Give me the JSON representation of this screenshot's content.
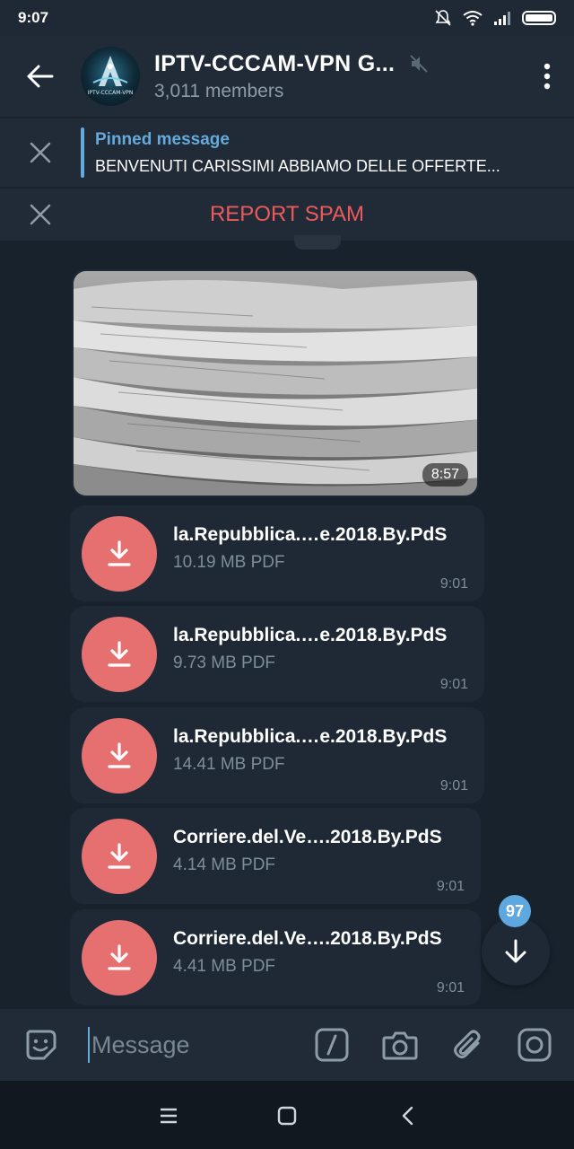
{
  "status_bar": {
    "time": "9:07"
  },
  "header": {
    "title": "IPTV-CCCAM-VPN G...",
    "subtitle": "3,011 members",
    "avatar_text": "IPTV-CCCAM-VPN"
  },
  "pinned": {
    "title": "Pinned message",
    "text": "BENVENUTI CARISSIMI ABBIAMO DELLE OFFERTE..."
  },
  "spam": {
    "label": "REPORT SPAM"
  },
  "messages": {
    "photo": {
      "time": "8:57"
    },
    "files": [
      {
        "name": "la.Repubblica.…e.2018.By.PdS",
        "size": "10.19 MB PDF",
        "time": "9:01"
      },
      {
        "name": "la.Repubblica.…e.2018.By.PdS",
        "size": "9.73 MB PDF",
        "time": "9:01"
      },
      {
        "name": "la.Repubblica.…e.2018.By.PdS",
        "size": "14.41 MB PDF",
        "time": "9:01"
      },
      {
        "name": "Corriere.del.Ve….2018.By.PdS",
        "size": "4.14 MB PDF",
        "time": "9:01"
      },
      {
        "name": "Corriere.del.Ve….2018.By.PdS",
        "size": "4.41 MB PDF",
        "time": "9:01"
      }
    ]
  },
  "scroll_down": {
    "unread_count": "97"
  },
  "input": {
    "placeholder": "Message"
  },
  "colors": {
    "accent": "#64aadb",
    "spam": "#ec5a5c",
    "download": "#e66f70",
    "background": "#18222d",
    "bubble": "#1f2935"
  },
  "icons": [
    "back-arrow-icon",
    "mute-icon",
    "more-vert-icon",
    "close-icon",
    "download-icon",
    "arrow-down-icon",
    "sticker-icon",
    "slash-command-icon",
    "camera-icon",
    "attach-icon",
    "instagram-camera-icon"
  ]
}
